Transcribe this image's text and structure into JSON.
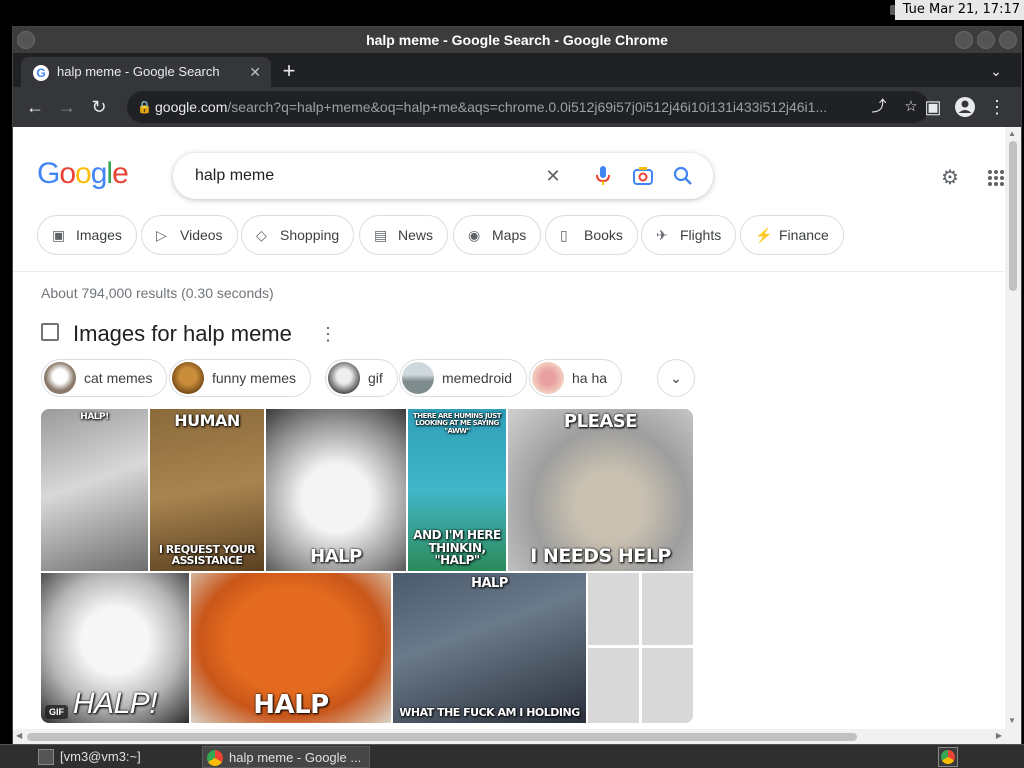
{
  "system": {
    "clock": "Tue Mar 21, 17:17"
  },
  "window": {
    "title": "halp meme - Google Search - Google Chrome"
  },
  "tabs": [
    {
      "title": "halp meme - Google Search",
      "close": "✕"
    }
  ],
  "tabstrip": {
    "new_tab": "+",
    "tab_menu": "⌄"
  },
  "toolbar": {
    "back": "←",
    "forward": "→",
    "reload": "↻",
    "url_host": "google.com",
    "url_path": "/search?q=halp+meme&oq=halp+me&aqs=chrome.0.0i512j69i57j0i512j46i10i131i433i512j46i1...",
    "share": "⤴",
    "bookmark": "☆",
    "sidepanel": "▣",
    "menu": "⋮"
  },
  "search": {
    "logo": [
      "G",
      "o",
      "o",
      "g",
      "l",
      "e"
    ],
    "query": "halp meme",
    "clear": "✕",
    "voice": "🎤",
    "lens": "⌾",
    "submit": "⌕"
  },
  "header_icons": {
    "settings": "⚙",
    "apps": "⋮⋮⋮"
  },
  "filter_chips": [
    {
      "label": "Images",
      "icon": "▣"
    },
    {
      "label": "Videos",
      "icon": "▷"
    },
    {
      "label": "Shopping",
      "icon": "◇"
    },
    {
      "label": "News",
      "icon": "▤"
    },
    {
      "label": "Maps",
      "icon": "◉"
    },
    {
      "label": "Books",
      "icon": "▯"
    },
    {
      "label": "Flights",
      "icon": "✈"
    },
    {
      "label": "Finance",
      "icon": "⚡"
    }
  ],
  "results_stats": "About 794,000 results (0.30 seconds)",
  "images_section": {
    "title": "Images for halp meme",
    "more": "⋮",
    "related": [
      "cat memes",
      "funny memes",
      "gif",
      "memedroid",
      "ha ha"
    ],
    "expand": "⌄",
    "tiles": [
      {
        "top": "HALP!",
        "bottom": ""
      },
      {
        "top": "HUMAN",
        "bottom": "I REQUEST YOUR ASSISTANCE"
      },
      {
        "top": "",
        "bottom": "HALP"
      },
      {
        "top": "THERE ARE HUMINS JUST LOOKING AT ME SAYING \"AWW\"",
        "bottom": "AND I'M HERE THINKIN, \"HALP\""
      },
      {
        "top": "PLEASE",
        "bottom": "I NEEDS HELP"
      },
      {
        "top": "",
        "bottom": "HALP!",
        "badge": "GIF"
      },
      {
        "top": "",
        "bottom": "HALP"
      },
      {
        "top": "HALP",
        "bottom": "WHAT THE FUCK AM I HOLDING"
      },
      {
        "top": "",
        "bottom": ""
      }
    ]
  },
  "taskbar": {
    "items": [
      {
        "label": "[vm3@vm3:~]"
      },
      {
        "label": "halp meme - Google ..."
      }
    ]
  },
  "colors": {
    "google_blue": "#4285f4",
    "google_red": "#ea4335",
    "google_yellow": "#fbbc05",
    "google_green": "#34a853",
    "link_blue": "#1a73e8"
  }
}
